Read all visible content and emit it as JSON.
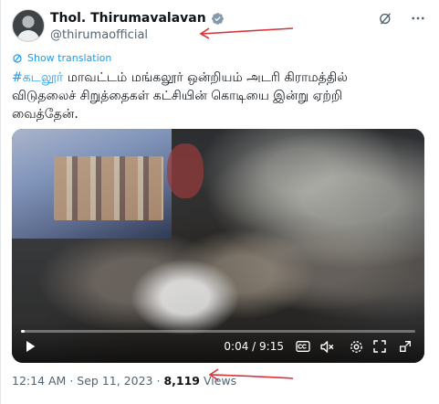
{
  "tweet": {
    "display_name": "Thol. Thirumavalavan",
    "handle": "@thirumaofficial",
    "show_translation": "Show translation",
    "hashtag": "#கடலூர்",
    "text_line1_rest": " மாவட்டம் மங்கலூர் ஒன்றியம் அடரி கிராமத்தில்",
    "text_line2": "விடுதலைச் சிறுத்தைகள் கட்சியின் கொடியை இன்று ஏற்றி",
    "text_line3": "வைத்தேன்.",
    "time": "12:14 AM",
    "dot": "·",
    "date": "Sep 11, 2023",
    "views_count": "8,119",
    "views_label": "Views"
  },
  "video": {
    "time_display": "0:04 / 9:15",
    "progress_fraction": 0.0072
  },
  "colors": {
    "accent": "#1d9bf0",
    "annotation": "#d9343a"
  },
  "icons": [
    "verified-badge-icon",
    "grok-icon",
    "more-icon",
    "translate-icon",
    "play-icon",
    "captions-icon",
    "volume-mute-icon",
    "settings-icon",
    "fullscreen-icon",
    "external-link-icon"
  ]
}
